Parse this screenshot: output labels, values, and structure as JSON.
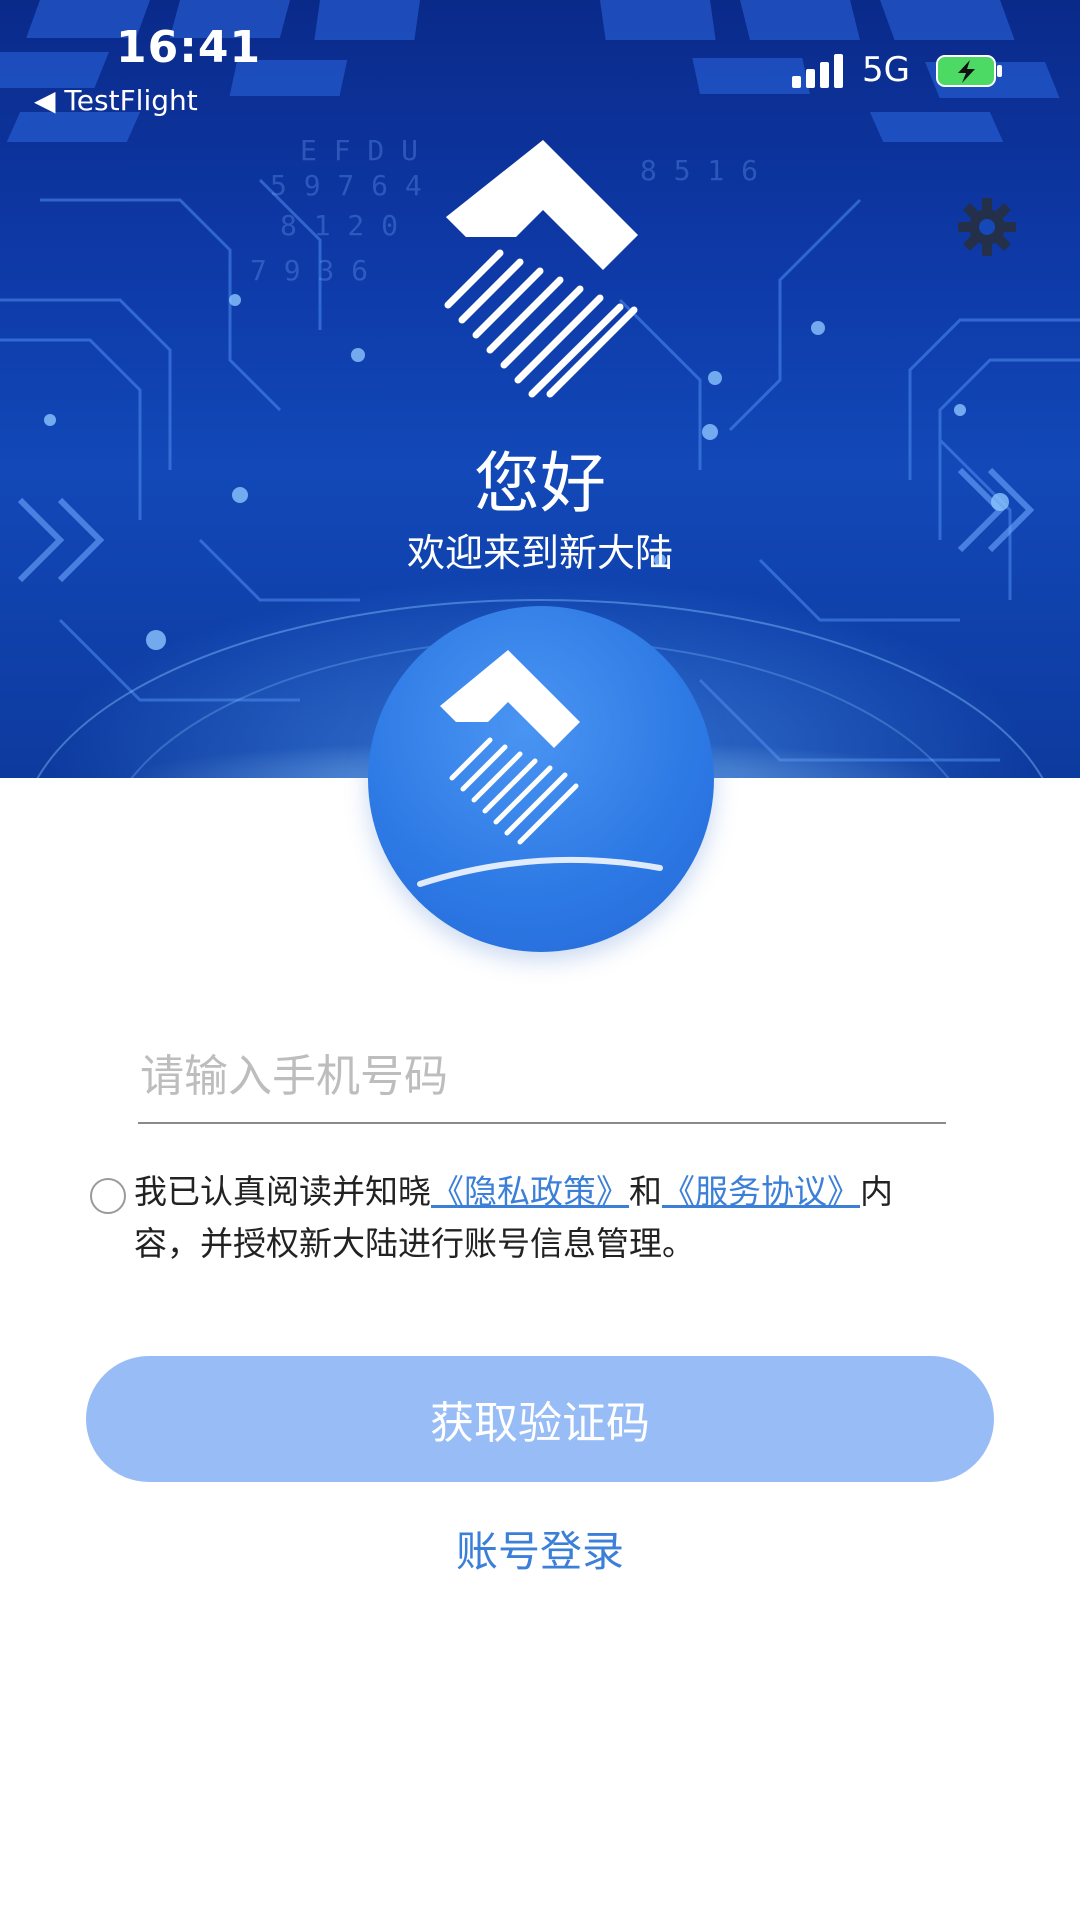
{
  "status_bar": {
    "time": "16:41",
    "back_app": "◀ TestFlight",
    "network": "5G"
  },
  "header": {
    "greeting": "您好",
    "welcome": "欢迎来到新大陆"
  },
  "icons": {
    "settings": "gear-icon",
    "signal": "signal-bars-icon",
    "battery": "battery-charging-icon",
    "logo": "xindalu-logo"
  },
  "form": {
    "phone_placeholder": "请输入手机号码",
    "phone_value": ""
  },
  "agreement": {
    "checked": false,
    "prefix": "我已认真阅读并知晓",
    "privacy_link": "《隐私政策》",
    "and": "和",
    "service_link": "《服务协议》",
    "suffix": "内容，并授权新大陆进行账号信息管理。"
  },
  "actions": {
    "get_code": "获取验证码",
    "account_login": "账号登录"
  },
  "colors": {
    "primary": "#3b7fd9",
    "button_disabled": "#98bdf6",
    "hero_dark": "#0a2a8a",
    "battery_green": "#4cd964"
  }
}
